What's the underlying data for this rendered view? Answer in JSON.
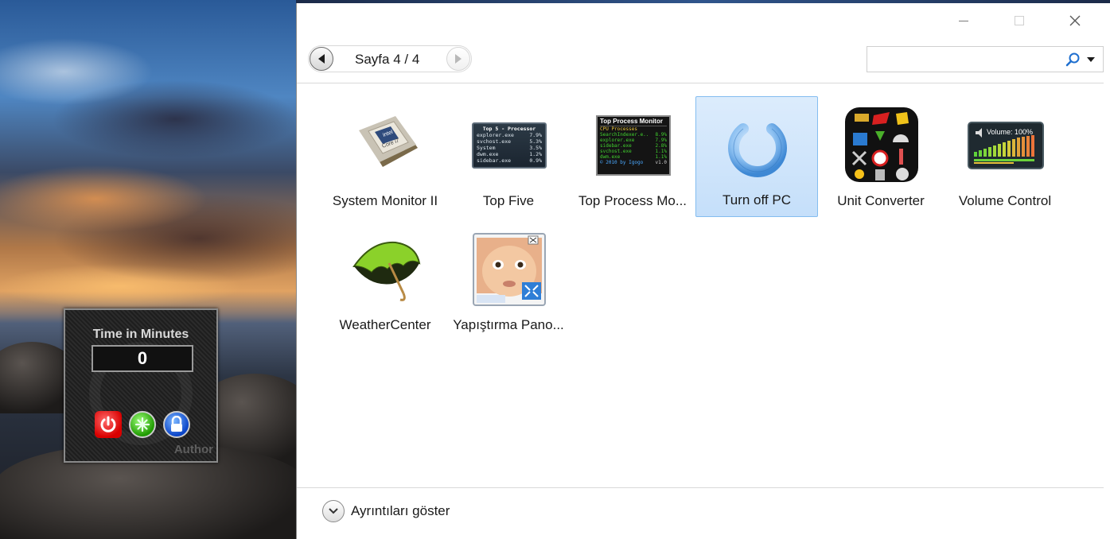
{
  "gadget": {
    "title": "Time in Minutes",
    "counter": "0",
    "author": "Author",
    "icons": [
      "power-icon",
      "reset-icon",
      "lock-icon"
    ]
  },
  "window": {
    "pager": {
      "text": "Sayfa 4 / 4"
    },
    "search": {
      "value": "",
      "placeholder": ""
    },
    "details_label": "Ayrıntıları göster"
  },
  "tiles": [
    {
      "label": "System Monitor II",
      "icon": "cpu-chip-icon",
      "selected": false
    },
    {
      "label": "Top Five",
      "icon": "top-five-processor-icon",
      "selected": false,
      "preview": {
        "title": "Top 5 - Processor",
        "rows": [
          [
            "explorer.exe",
            "7.9%"
          ],
          [
            "svchost.exe",
            "5.3%"
          ],
          [
            "System",
            "3.5%"
          ],
          [
            "dwm.exe",
            "1.2%"
          ],
          [
            "sidebar.exe",
            "0.9%"
          ]
        ]
      }
    },
    {
      "label": "Top Process Mo...",
      "icon": "top-process-monitor-icon",
      "selected": false,
      "preview": {
        "title": "Top Process Monitor",
        "subtitle": "CPU Processes",
        "rows": [
          [
            "SearchIndexer.e..",
            "8.9%"
          ],
          [
            "explorer.exe",
            "7.9%"
          ],
          [
            "sidebar.exe",
            "2.8%"
          ],
          [
            "svchost.exe",
            "1.1%"
          ],
          [
            "dwm.exe",
            "1.1%"
          ]
        ],
        "footer": "© 2010 by Igogo",
        "version": "v1.0"
      }
    },
    {
      "label": "Turn off PC",
      "icon": "power-button-icon",
      "selected": true
    },
    {
      "label": "Unit Converter",
      "icon": "unit-converter-icon",
      "selected": false
    },
    {
      "label": "Volume Control",
      "icon": "volume-control-icon",
      "selected": false,
      "preview": {
        "text": "Volume: 100%"
      }
    },
    {
      "label": "WeatherCenter",
      "icon": "umbrella-icon",
      "selected": false
    },
    {
      "label": "Yapıştırma Pano...",
      "icon": "baby-photo-icon",
      "selected": false
    }
  ],
  "colors": {
    "selected_bg": "#c5dffa",
    "selected_border": "#84bdf0",
    "text": "#1a1a1a"
  }
}
